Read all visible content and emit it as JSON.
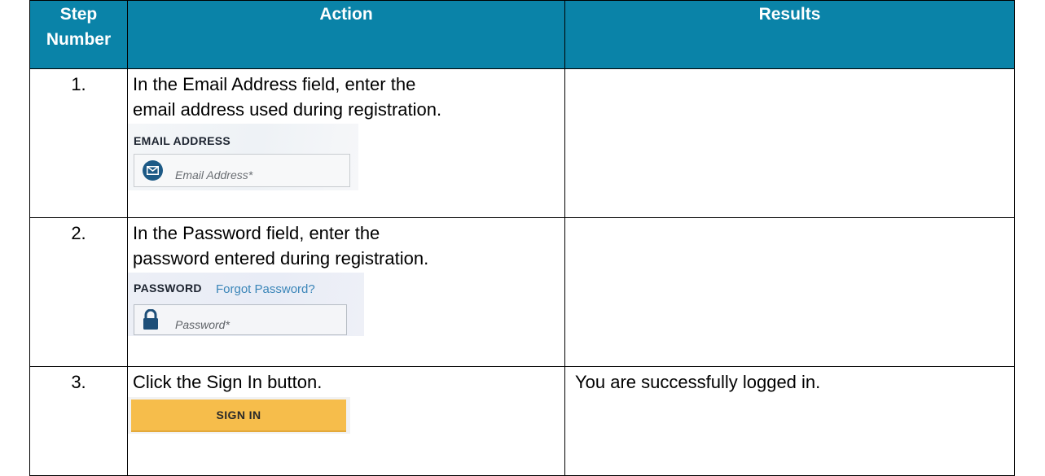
{
  "table": {
    "headers": [
      "Step Number",
      "Action",
      "Results"
    ],
    "header_step_line1": "Step",
    "header_step_line2": "Number",
    "header_bg": "#0a83a8",
    "rows": [
      {
        "number": "1.",
        "action_line1": "In the Email Address field, enter the",
        "action_line2": "email address used during registration.",
        "result": ""
      },
      {
        "number": "2.",
        "action_line1": "In the Password field, enter the",
        "action_line2": "password entered during registration.",
        "result": ""
      },
      {
        "number": "3.",
        "action_line1": "Click the Sign In button.",
        "result": "You are successfully logged in."
      }
    ]
  },
  "email_snippet": {
    "label": "EMAIL ADDRESS",
    "placeholder": "Email Address*",
    "icon": "envelope-icon"
  },
  "password_snippet": {
    "label": "PASSWORD",
    "forgot_link": "Forgot Password?",
    "placeholder": "Password*",
    "icon": "lock-icon"
  },
  "signin_snippet": {
    "button_label": "SIGN IN",
    "button_color": "#f6bd4b"
  }
}
